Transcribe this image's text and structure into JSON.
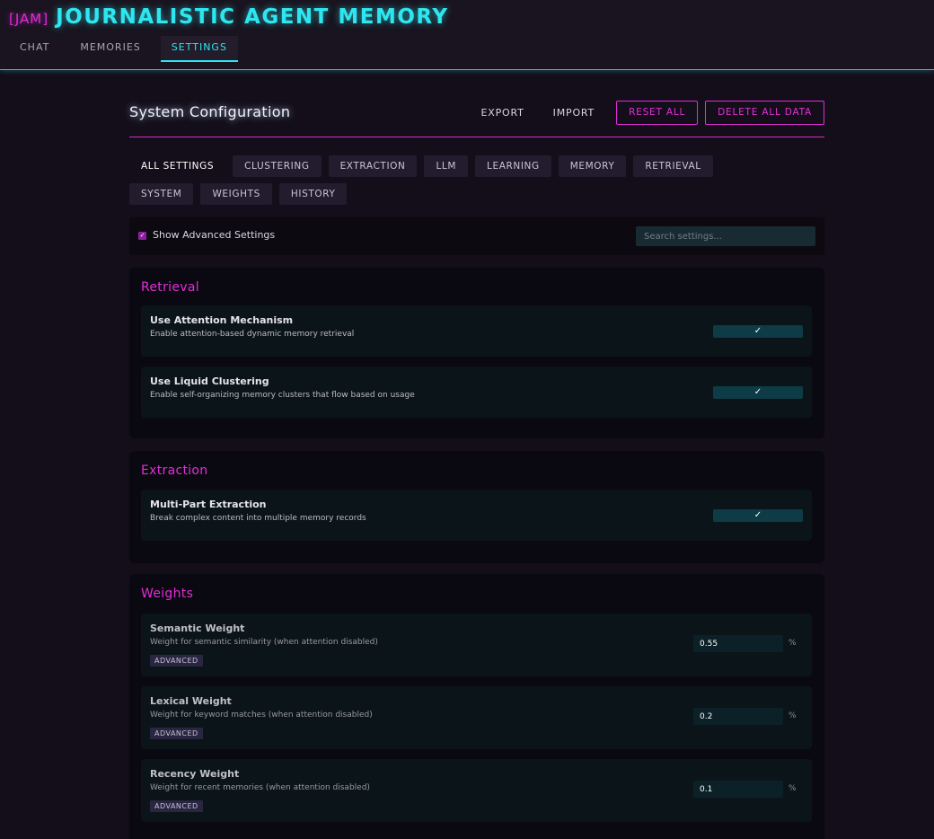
{
  "app": {
    "tag": "[JAM]",
    "title": "JOURNALISTIC AGENT MEMORY"
  },
  "nav": {
    "tabs": [
      {
        "label": "CHAT"
      },
      {
        "label": "MEMORIES"
      },
      {
        "label": "SETTINGS"
      }
    ],
    "active": "SETTINGS"
  },
  "config": {
    "title": "System Configuration",
    "export_label": "EXPORT",
    "import_label": "IMPORT",
    "reset_label": "RESET ALL",
    "delete_label": "DELETE ALL DATA"
  },
  "filters": {
    "row1": [
      "ALL SETTINGS",
      "CLUSTERING",
      "EXTRACTION",
      "LLM",
      "LEARNING",
      "MEMORY",
      "RETRIEVAL"
    ],
    "row2": [
      "SYSTEM",
      "WEIGHTS",
      "HISTORY"
    ],
    "active": "ALL SETTINGS"
  },
  "search": {
    "advanced_label": "Show Advanced Settings",
    "advanced_checked": true,
    "placeholder": "Search settings..."
  },
  "sections": {
    "retrieval": {
      "title": "Retrieval",
      "settings": [
        {
          "name": "Use Attention Mechanism",
          "description": "Enable attention-based dynamic memory retrieval",
          "value": "✓"
        },
        {
          "name": "Use Liquid Clustering",
          "description": "Enable self-organizing memory clusters that flow based on usage",
          "value": "✓"
        }
      ]
    },
    "extraction": {
      "title": "Extraction",
      "settings": [
        {
          "name": "Multi-Part Extraction",
          "description": "Break complex content into multiple memory records",
          "value": "✓"
        }
      ]
    },
    "weights": {
      "title": "Weights",
      "settings": [
        {
          "name": "Semantic Weight",
          "description": "Weight for semantic similarity (when attention disabled)",
          "value": "0.55",
          "unit": "%",
          "badge": "ADVANCED"
        },
        {
          "name": "Lexical Weight",
          "description": "Weight for keyword matches (when attention disabled)",
          "value": "0.2",
          "unit": "%",
          "badge": "ADVANCED"
        },
        {
          "name": "Recency Weight",
          "description": "Weight for recent memories (when attention disabled)",
          "value": "0.1",
          "unit": "%",
          "badge": "ADVANCED"
        }
      ]
    }
  },
  "colors": {
    "accent_cyan": "#2ee6f0",
    "accent_magenta": "#e22fd8",
    "background": "#130e19"
  }
}
